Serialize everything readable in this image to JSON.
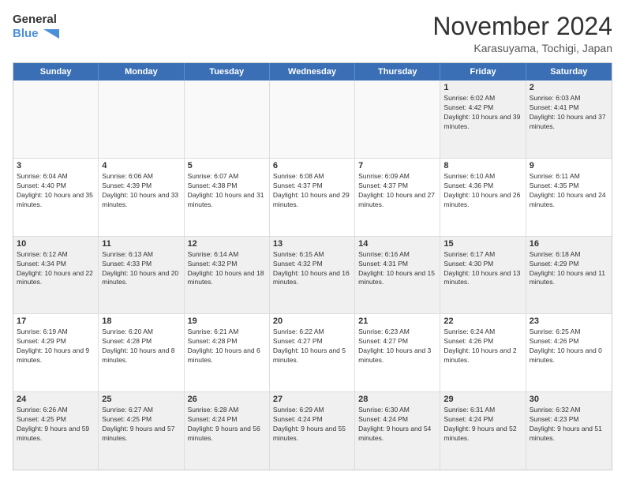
{
  "logo": {
    "line1": "General",
    "line2": "Blue"
  },
  "title": "November 2024",
  "subtitle": "Karasuyama, Tochigi, Japan",
  "days": [
    "Sunday",
    "Monday",
    "Tuesday",
    "Wednesday",
    "Thursday",
    "Friday",
    "Saturday"
  ],
  "weeks": [
    [
      {
        "num": "",
        "info": ""
      },
      {
        "num": "",
        "info": ""
      },
      {
        "num": "",
        "info": ""
      },
      {
        "num": "",
        "info": ""
      },
      {
        "num": "",
        "info": ""
      },
      {
        "num": "1",
        "info": "Sunrise: 6:02 AM\nSunset: 4:42 PM\nDaylight: 10 hours and 39 minutes."
      },
      {
        "num": "2",
        "info": "Sunrise: 6:03 AM\nSunset: 4:41 PM\nDaylight: 10 hours and 37 minutes."
      }
    ],
    [
      {
        "num": "3",
        "info": "Sunrise: 6:04 AM\nSunset: 4:40 PM\nDaylight: 10 hours and 35 minutes."
      },
      {
        "num": "4",
        "info": "Sunrise: 6:06 AM\nSunset: 4:39 PM\nDaylight: 10 hours and 33 minutes."
      },
      {
        "num": "5",
        "info": "Sunrise: 6:07 AM\nSunset: 4:38 PM\nDaylight: 10 hours and 31 minutes."
      },
      {
        "num": "6",
        "info": "Sunrise: 6:08 AM\nSunset: 4:37 PM\nDaylight: 10 hours and 29 minutes."
      },
      {
        "num": "7",
        "info": "Sunrise: 6:09 AM\nSunset: 4:37 PM\nDaylight: 10 hours and 27 minutes."
      },
      {
        "num": "8",
        "info": "Sunrise: 6:10 AM\nSunset: 4:36 PM\nDaylight: 10 hours and 26 minutes."
      },
      {
        "num": "9",
        "info": "Sunrise: 6:11 AM\nSunset: 4:35 PM\nDaylight: 10 hours and 24 minutes."
      }
    ],
    [
      {
        "num": "10",
        "info": "Sunrise: 6:12 AM\nSunset: 4:34 PM\nDaylight: 10 hours and 22 minutes."
      },
      {
        "num": "11",
        "info": "Sunrise: 6:13 AM\nSunset: 4:33 PM\nDaylight: 10 hours and 20 minutes."
      },
      {
        "num": "12",
        "info": "Sunrise: 6:14 AM\nSunset: 4:32 PM\nDaylight: 10 hours and 18 minutes."
      },
      {
        "num": "13",
        "info": "Sunrise: 6:15 AM\nSunset: 4:32 PM\nDaylight: 10 hours and 16 minutes."
      },
      {
        "num": "14",
        "info": "Sunrise: 6:16 AM\nSunset: 4:31 PM\nDaylight: 10 hours and 15 minutes."
      },
      {
        "num": "15",
        "info": "Sunrise: 6:17 AM\nSunset: 4:30 PM\nDaylight: 10 hours and 13 minutes."
      },
      {
        "num": "16",
        "info": "Sunrise: 6:18 AM\nSunset: 4:29 PM\nDaylight: 10 hours and 11 minutes."
      }
    ],
    [
      {
        "num": "17",
        "info": "Sunrise: 6:19 AM\nSunset: 4:29 PM\nDaylight: 10 hours and 9 minutes."
      },
      {
        "num": "18",
        "info": "Sunrise: 6:20 AM\nSunset: 4:28 PM\nDaylight: 10 hours and 8 minutes."
      },
      {
        "num": "19",
        "info": "Sunrise: 6:21 AM\nSunset: 4:28 PM\nDaylight: 10 hours and 6 minutes."
      },
      {
        "num": "20",
        "info": "Sunrise: 6:22 AM\nSunset: 4:27 PM\nDaylight: 10 hours and 5 minutes."
      },
      {
        "num": "21",
        "info": "Sunrise: 6:23 AM\nSunset: 4:27 PM\nDaylight: 10 hours and 3 minutes."
      },
      {
        "num": "22",
        "info": "Sunrise: 6:24 AM\nSunset: 4:26 PM\nDaylight: 10 hours and 2 minutes."
      },
      {
        "num": "23",
        "info": "Sunrise: 6:25 AM\nSunset: 4:26 PM\nDaylight: 10 hours and 0 minutes."
      }
    ],
    [
      {
        "num": "24",
        "info": "Sunrise: 6:26 AM\nSunset: 4:25 PM\nDaylight: 9 hours and 59 minutes."
      },
      {
        "num": "25",
        "info": "Sunrise: 6:27 AM\nSunset: 4:25 PM\nDaylight: 9 hours and 57 minutes."
      },
      {
        "num": "26",
        "info": "Sunrise: 6:28 AM\nSunset: 4:24 PM\nDaylight: 9 hours and 56 minutes."
      },
      {
        "num": "27",
        "info": "Sunrise: 6:29 AM\nSunset: 4:24 PM\nDaylight: 9 hours and 55 minutes."
      },
      {
        "num": "28",
        "info": "Sunrise: 6:30 AM\nSunset: 4:24 PM\nDaylight: 9 hours and 54 minutes."
      },
      {
        "num": "29",
        "info": "Sunrise: 6:31 AM\nSunset: 4:24 PM\nDaylight: 9 hours and 52 minutes."
      },
      {
        "num": "30",
        "info": "Sunrise: 6:32 AM\nSunset: 4:23 PM\nDaylight: 9 hours and 51 minutes."
      }
    ]
  ],
  "shaded_rows": [
    0,
    2,
    4
  ]
}
